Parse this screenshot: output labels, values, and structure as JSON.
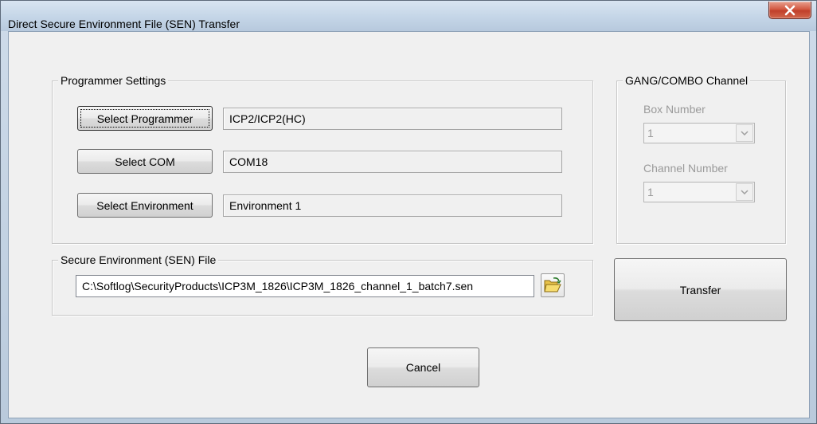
{
  "window": {
    "title": "Direct Secure Environment File (SEN) Transfer",
    "close_glyph": "X"
  },
  "programmer_settings": {
    "legend": "Programmer Settings",
    "select_programmer_label": "Select Programmer",
    "programmer_value": "ICP2/ICP2(HC)",
    "select_com_label": "Select COM",
    "com_value": "COM18",
    "select_environment_label": "Select Environment",
    "environment_value": "Environment 1"
  },
  "gang_combo": {
    "legend": "GANG/COMBO Channel",
    "box_number_label": "Box Number",
    "box_number_value": "1",
    "channel_number_label": "Channel Number",
    "channel_number_value": "1"
  },
  "sen_file": {
    "legend": "Secure Environment (SEN) File",
    "path": "C:\\Softlog\\SecurityProducts\\ICP3M_1826\\ICP3M_1826_channel_1_batch7.sen",
    "browse_icon": "open-folder-icon"
  },
  "actions": {
    "transfer_label": "Transfer",
    "cancel_label": "Cancel"
  },
  "colors": {
    "close_button": "#c8432e",
    "dialog_background": "#f0f0f0",
    "disabled_text": "#9a9a9a"
  }
}
